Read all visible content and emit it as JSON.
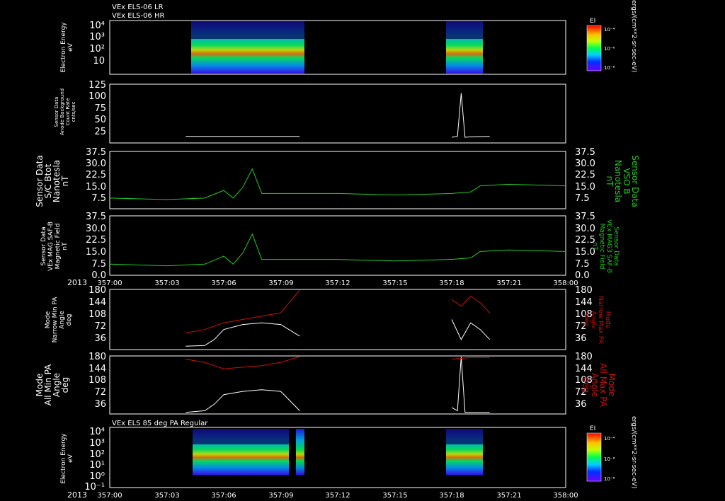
{
  "header": {
    "line1": "VEx ELS-06 LR",
    "line2": "VEx ELS-06 HR",
    "bottom_title": "VEx ELS 85 deg PA Regular"
  },
  "colorbar": {
    "title": "EI",
    "units": "ergs/(cm**2-sr-sec-eV)",
    "ticks": [
      "10⁻⁴",
      "10⁻⁶",
      "10⁻⁸"
    ]
  },
  "time_axis": {
    "year": "2013",
    "ticks": [
      "357:00",
      "357:03",
      "357:06",
      "357:09",
      "357:12",
      "357:15",
      "357:18",
      "357:21",
      "358:00"
    ]
  },
  "colors": {
    "white": "#ffffff",
    "green": "#22cc22",
    "red": "#cc1111",
    "background": "#000000"
  },
  "chart_data": [
    {
      "type": "heatmap",
      "title": "VEx ELS-06 LR / VEx ELS-06 HR",
      "ylabel": [
        "Electron Energy",
        "eV"
      ],
      "yticks": [
        "10⁴",
        "10³",
        "10²",
        "10"
      ],
      "scale": "log",
      "zlabel": "EI ergs/(cm**2-sr-sec-eV)",
      "data_intervals": [
        [
          "357:04",
          "357:10"
        ],
        [
          "357:18",
          "357:20"
        ]
      ]
    },
    {
      "type": "line",
      "ylabel": [
        "Sensor Data",
        "Anode Background",
        "Count Rate",
        "cnts/sec"
      ],
      "yticks": [
        "125",
        "100",
        "75",
        "50",
        "25"
      ],
      "ylim": [
        0,
        125
      ],
      "series": [
        {
          "color": "white",
          "segments": [
            {
              "x": [
                "357:04",
                "357:05",
                "357:06",
                "357:07",
                "357:08",
                "357:09",
                "357:10"
              ],
              "y": [
                14,
                14,
                14,
                14,
                14,
                14,
                14
              ]
            },
            {
              "x": [
                "357:18",
                "357:18.3",
                "357:18.5",
                "357:18.7",
                "357:19",
                "357:20"
              ],
              "y": [
                12,
                14,
                106,
                12,
                13,
                14
              ]
            }
          ]
        }
      ]
    },
    {
      "type": "line",
      "ylabel": [
        "Sensor Data",
        "S/C Btot",
        "Nanotesla",
        "nT"
      ],
      "ylabel_right": [
        "Sensor Data",
        "VSO B",
        "Nanotesla",
        "nT"
      ],
      "yticks": [
        "37.5",
        "30.0",
        "22.5",
        "15.0",
        "7.5"
      ],
      "ylim": [
        0,
        37.5
      ],
      "series": [
        {
          "color": "green",
          "x": [
            "357:00",
            "357:03",
            "357:05",
            "357:06",
            "357:06.5",
            "357:07",
            "357:07.5",
            "357:08",
            "357:09",
            "357:12",
            "357:15",
            "357:18",
            "357:19",
            "357:19.5",
            "357:21",
            "358:00"
          ],
          "y": [
            7,
            6,
            7,
            12,
            7,
            14,
            26,
            10,
            10,
            10,
            9,
            10,
            11,
            15,
            16,
            15
          ]
        }
      ]
    },
    {
      "type": "line",
      "ylabel": [
        "Sensor Data",
        "VEx MAG SAF-B",
        "Magnetic Field",
        "nT"
      ],
      "ylabel_right": [
        "Sensor Data",
        "VEx MAG3 SAF-B",
        "Magnetic Field",
        "nT"
      ],
      "yticks": [
        "37.5",
        "30.0",
        "22.5",
        "15.0",
        "7.5",
        "0.0"
      ],
      "ylim": [
        0,
        37.5
      ],
      "series": [
        {
          "color": "green",
          "x": [
            "357:00",
            "357:03",
            "357:05",
            "357:06",
            "357:06.5",
            "357:07",
            "357:07.5",
            "357:08",
            "357:09",
            "357:12",
            "357:15",
            "357:18",
            "357:19",
            "357:19.5",
            "357:21",
            "358:00"
          ],
          "y": [
            7,
            6,
            7,
            12,
            7,
            14,
            26,
            10,
            10,
            10,
            9,
            10,
            11,
            15,
            16,
            15
          ]
        }
      ]
    },
    {
      "type": "line",
      "ylabel": [
        "Mode",
        "Narrow Min PA",
        "Angle",
        "deg"
      ],
      "ylabel_right": [
        "Mode",
        "Narrow Max PA",
        "Angle",
        "deg"
      ],
      "yticks": [
        "180",
        "144",
        "108",
        "72",
        "36"
      ],
      "ylim": [
        0,
        180
      ],
      "series": [
        {
          "name": "Min PA",
          "color": "white",
          "segments": [
            {
              "x": [
                "357:04",
                "357:05",
                "357:05.5",
                "357:06",
                "357:07",
                "357:08",
                "357:09",
                "357:10"
              ],
              "y": [
                10,
                12,
                30,
                60,
                75,
                80,
                75,
                40
              ]
            },
            {
              "x": [
                "357:18",
                "357:18.5",
                "357:19",
                "357:19.5",
                "357:20"
              ],
              "y": [
                90,
                30,
                80,
                60,
                30
              ]
            }
          ]
        },
        {
          "name": "Max PA",
          "color": "red",
          "segments": [
            {
              "x": [
                "357:04",
                "357:05",
                "357:05.5",
                "357:06",
                "357:07",
                "357:08",
                "357:09",
                "357:10"
              ],
              "y": [
                50,
                60,
                70,
                80,
                90,
                100,
                110,
                180
              ]
            },
            {
              "x": [
                "357:18",
                "357:18.5",
                "357:19",
                "357:19.5",
                "357:20"
              ],
              "y": [
                150,
                130,
                160,
                140,
                110
              ]
            }
          ]
        }
      ]
    },
    {
      "type": "line",
      "ylabel": [
        "Mode",
        "All Min PA",
        "Angle",
        "deg"
      ],
      "ylabel_right": [
        "Mode",
        "All Max PA",
        "Angle",
        "deg"
      ],
      "yticks": [
        "180",
        "144",
        "108",
        "72",
        "36"
      ],
      "ylim": [
        0,
        180
      ],
      "series": [
        {
          "name": "Min PA",
          "color": "white",
          "segments": [
            {
              "x": [
                "357:04",
                "357:05",
                "357:05.5",
                "357:06",
                "357:07",
                "357:08",
                "357:09",
                "357:10"
              ],
              "y": [
                5,
                10,
                30,
                60,
                70,
                75,
                70,
                10
              ]
            },
            {
              "x": [
                "357:18",
                "357:18.3",
                "357:18.5",
                "357:18.7",
                "357:20"
              ],
              "y": [
                20,
                10,
                180,
                5,
                5
              ]
            }
          ]
        },
        {
          "name": "Max PA",
          "color": "red",
          "segments": [
            {
              "x": [
                "357:04",
                "357:05",
                "357:05.5",
                "357:06",
                "357:07",
                "357:08",
                "357:09",
                "357:10"
              ],
              "y": [
                170,
                160,
                150,
                140,
                145,
                150,
                160,
                180
              ]
            },
            {
              "x": [
                "357:18",
                "357:19",
                "357:20"
              ],
              "y": [
                170,
                175,
                175
              ]
            }
          ]
        }
      ]
    },
    {
      "type": "heatmap",
      "title": "VEx ELS 85 deg PA Regular",
      "ylabel": [
        "Electron Energy",
        "eV"
      ],
      "yticks": [
        "10⁴",
        "10³",
        "10²",
        "10¹",
        "10⁰",
        "10⁻¹"
      ],
      "scale": "log",
      "zlabel": "EI ergs/(cm**2-sr-sec-eV)",
      "data_intervals": [
        [
          "357:04",
          "357:10"
        ],
        [
          "357:18",
          "357:20"
        ]
      ]
    }
  ]
}
